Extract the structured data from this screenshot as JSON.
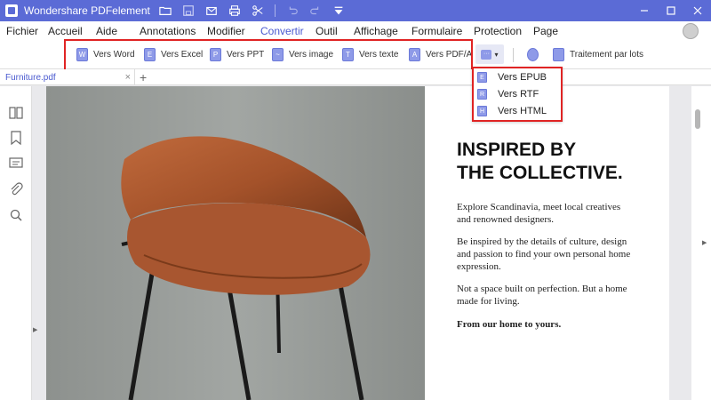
{
  "titlebar": {
    "app_title": "Wondershare PDFelement",
    "icons": [
      "folder-icon",
      "save-icon",
      "mail-icon",
      "print-icon",
      "scissors-icon",
      "undo-icon",
      "redo-icon",
      "quick-access-dropdown-icon"
    ],
    "controls": [
      "minimize-icon",
      "maximize-icon",
      "close-icon"
    ]
  },
  "menubar": {
    "items": [
      {
        "label": "Fichier"
      },
      {
        "label": "Accueil"
      },
      {
        "label": "Aide"
      },
      {
        "label": "Annotations"
      },
      {
        "label": "Modifier"
      },
      {
        "label": "Convertir",
        "active": true
      },
      {
        "label": "Outil"
      },
      {
        "label": "Affichage"
      },
      {
        "label": "Formulaire"
      },
      {
        "label": "Protection"
      },
      {
        "label": "Page"
      }
    ]
  },
  "ribbon": {
    "buttons": [
      {
        "label": "Vers Word",
        "icon_letter": "W"
      },
      {
        "label": "Vers Excel",
        "icon_letter": "E"
      },
      {
        "label": "Vers PPT",
        "icon_letter": "P"
      },
      {
        "label": "Vers image",
        "icon_letter": "~"
      },
      {
        "label": "Vers texte",
        "icon_letter": "T"
      },
      {
        "label": "Vers PDF/A",
        "icon_letter": "A"
      }
    ],
    "more_icon": "more-formats-icon",
    "extra": [
      {
        "label": "",
        "icon": "ocr-icon"
      },
      {
        "label": "Traitement par lots",
        "icon": "batch-icon"
      }
    ]
  },
  "dropdown": {
    "items": [
      {
        "label": "Vers EPUB",
        "icon_letter": "E"
      },
      {
        "label": "Vers RTF",
        "icon_letter": "R"
      },
      {
        "label": "Vers HTML",
        "icon_letter": "H"
      }
    ]
  },
  "tabs": {
    "active": "Furniture.pdf",
    "close": "×",
    "add": "+"
  },
  "sidebar": {
    "icons": [
      "pages-icon",
      "bookmark-icon",
      "comment-icon",
      "attachment-icon",
      "search-icon"
    ]
  },
  "document": {
    "headline": [
      "INSPIRED BY",
      "THE COLLECTIVE."
    ],
    "paragraphs": [
      "Explore Scandinavia, meet local creatives and renowned designers.",
      "Be inspired by the details of culture, design and passion to find your own personal home expression.",
      "Not a space built on perfection. But a home made for living."
    ],
    "closing": "From our home to yours."
  },
  "colors": {
    "accent": "#5b6bd6",
    "highlight": "#e02424",
    "active_menu": "#4a5ad0"
  }
}
